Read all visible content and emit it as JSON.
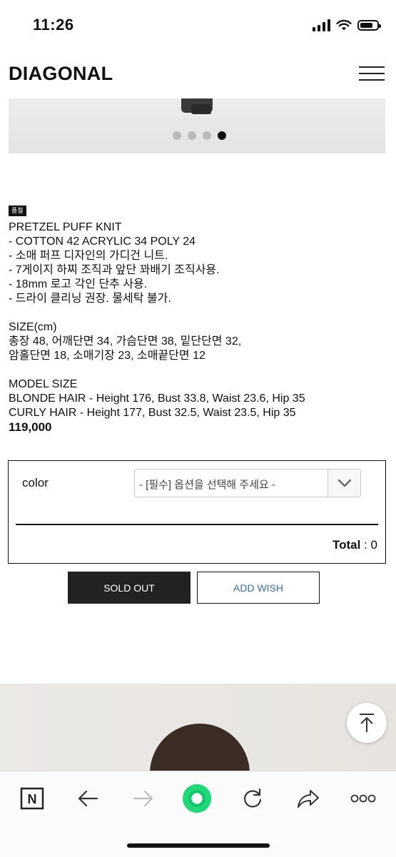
{
  "status": {
    "time": "11:26"
  },
  "header": {
    "brand": "DIAGONAL"
  },
  "carousel": {
    "total_dots": 4,
    "active_index": 3
  },
  "product": {
    "tag": "품절",
    "name": "PRETZEL PUFF KNIT",
    "details": [
      "- COTTON 42 ACRYLIC 34 POLY 24",
      "- 소매 퍼프 디자인의 가디건 니트.",
      "- 7게이지 하찌 조직과 앞단 꽈배기 조직사용.",
      "- 18mm 로고 각인 단추 사용.",
      "- 드라이 클리닝 권장. 물세탁 불가."
    ],
    "size_title": "SIZE(cm)",
    "size_lines": [
      "총장 48, 어깨단면 34, 가슴단면 38, 밑단단면 32,",
      "암홀단면 18, 소매기장 23, 소매끝단면 12"
    ],
    "model_title": "MODEL SIZE",
    "model_lines": [
      "BLONDE HAIR - Height 176, Bust 33.8, Waist 23.6, Hip 35",
      "CURLY HAIR - Height 177, Bust 32.5, Waist 23.5, Hip 35"
    ],
    "price": "119,000"
  },
  "options": {
    "color_label": "color",
    "select_placeholder": "- [필수] 옵션을 선택해 주세요 -",
    "total_label": "Total",
    "total_sep": " : ",
    "total_value": "0"
  },
  "buttons": {
    "sold_out": "SOLD OUT",
    "add_wish": "ADD WISH"
  },
  "colors": {
    "wish_text": "#3a6fb0",
    "soldout_bg": "#222222",
    "tab_accent": "#1fd878"
  }
}
